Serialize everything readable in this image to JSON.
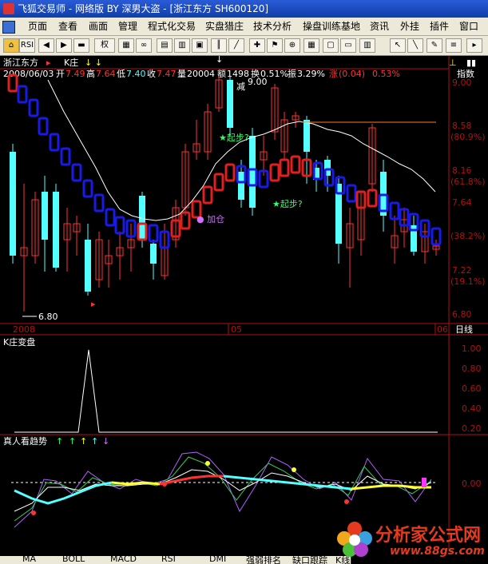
{
  "window": {
    "title": "飞狐交易师 - 网络版 BY 深男大盗 - [浙江东方 SH600120]"
  },
  "menu": [
    "页面",
    "查看",
    "画面",
    "管理",
    "程式化交易",
    "实盘猎庄",
    "技术分析",
    "操盘训练基地",
    "资讯",
    "外挂",
    "插件",
    "窗口"
  ],
  "toolbar": {
    "buttons": [
      "RSI",
      "权"
    ]
  },
  "header": {
    "stock_name": "浙江东方",
    "indicator": "K庄",
    "arrows": "↓ ↓",
    "date": "2008/06/03",
    "open_label": "开",
    "open": "7.49",
    "high_label": "高",
    "high": "7.64",
    "low_label": "低",
    "low": "7.40",
    "close_label": "收",
    "close": "7.47",
    "volume_label": "量",
    "volume": "20004",
    "amount_label": "额",
    "amount": "1498",
    "turnover_label": "换",
    "turnover": "0.51%",
    "amplitude_label": "振",
    "amplitude": "3.29%",
    "change_label": "涨",
    "change": "(0.04)",
    "change_pct": "0.53%",
    "right_label": "指数"
  },
  "price_axis": {
    "ticks": [
      "9.00",
      "8.58",
      "(80.9%)",
      "8.16",
      "(61.8%)",
      "7.64",
      "(38.2%)",
      "7.22",
      "(19.1%)",
      "6.80"
    ]
  },
  "annotations": {
    "reduce": "减",
    "start1": "★起步?",
    "start2": "★起步?",
    "add": "● 加仓",
    "high_marker": "9.00",
    "low_marker": "6.80"
  },
  "time_axis": {
    "labels": [
      "2008",
      "05",
      "06"
    ],
    "period": "日线"
  },
  "panel2": {
    "title": "K庄变盘",
    "ticks": [
      "1.00",
      "0.80",
      "0.60",
      "0.40",
      "0.20"
    ]
  },
  "panel3": {
    "title": "真人看趋势",
    "tick": "0.00"
  },
  "bottom_tabs": [
    "MA",
    "BOLL",
    "MACD",
    "RSI",
    "DMI",
    "强弱排名",
    "缺口跟踪",
    "K线图"
  ],
  "watermark": {
    "title": "分析家公式网",
    "url": "www.88gs.com"
  },
  "colors": {
    "up": "#ff3232",
    "down": "#54ffff",
    "k_up": "#e02020",
    "k_down": "#1a1ae6",
    "axis": "#b01010",
    "text_white": "#ffffff",
    "yellow": "#ffff00"
  }
}
